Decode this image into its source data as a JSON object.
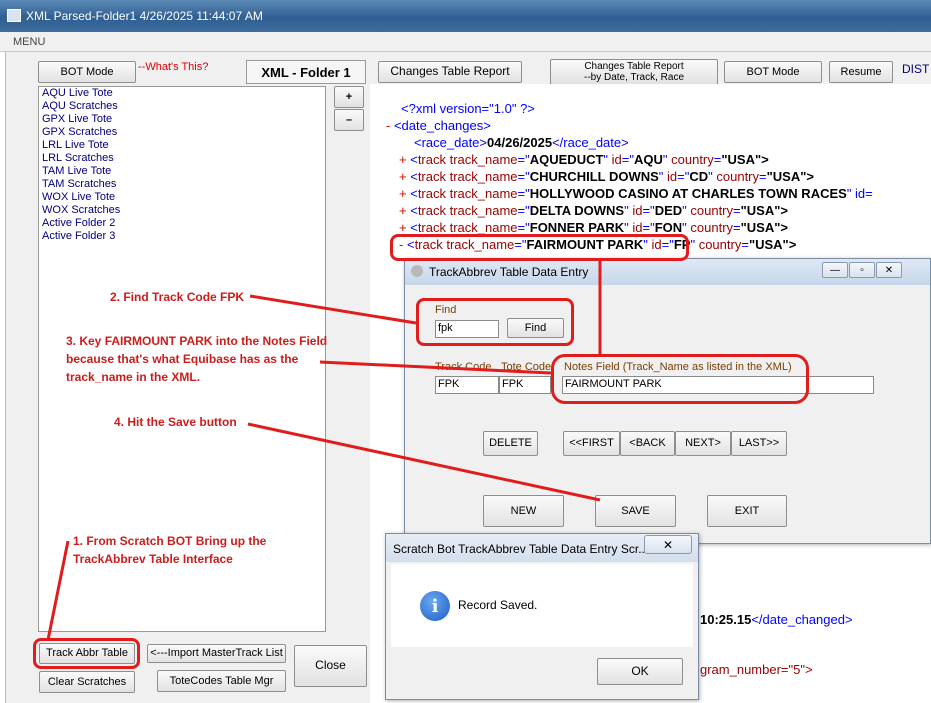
{
  "window": {
    "title": "XML Parsed-Folder1 4/26/2025 11:44:07 AM",
    "menu": "MENU"
  },
  "left_panel": {
    "bot_mode": "BOT Mode",
    "whats_this": "--What's This?",
    "folder_label": "XML - Folder 1",
    "plus": "+",
    "minus": "–",
    "items": [
      "AQU Live Tote",
      "AQU Scratches",
      "GPX Live Tote",
      "GPX Scratches",
      "LRL Live Tote",
      "LRL Scratches",
      "TAM Live Tote",
      "TAM Scratches",
      "WOX Live Tote",
      "WOX Scratches",
      "Active Folder 2",
      "Active Folder 3"
    ],
    "track_abbr_table": "Track Abbr Table",
    "import_master": "<---Import MasterTrack List",
    "close": "Close",
    "clear_scratches": "Clear Scratches",
    "totecodes_mgr": "ToteCodes Table Mgr"
  },
  "toolbar": {
    "changes_report": "Changes Table Report",
    "changes_report_by_line1": "Changes Table Report",
    "changes_report_by_line2": "--by Date, Track, Race",
    "bot_mode": "BOT Mode",
    "resume": "Resume",
    "dist": "DIST"
  },
  "xml": {
    "decl": "<?xml version=\"1.0\" ?>",
    "root_minus": "-",
    "root_tag": "<date_changes>",
    "race_date_open": "<race_date>",
    "race_date_value": "04/26/2025",
    "race_date_close": "</race_date>",
    "tracks": [
      {
        "marker": "+",
        "name": "AQUEDUCT",
        "id": "AQU",
        "country": "\"USA\">"
      },
      {
        "marker": "+",
        "name": "CHURCHILL DOWNS",
        "id": "CD",
        "country": "\"USA\">"
      },
      {
        "marker": "+",
        "name": "HOLLYWOOD CASINO AT CHARLES TOWN RACES",
        "id": "",
        "country": ""
      },
      {
        "marker": "+",
        "name": "DELTA DOWNS",
        "id": "DED",
        "country": "\"USA\">"
      },
      {
        "marker": "+",
        "name": "FONNER PARK",
        "id": "FON",
        "country": "\"USA\">"
      },
      {
        "marker": "-",
        "name": "FAIRMOUNT PARK",
        "id": "FP",
        "country": "\"USA\">"
      }
    ],
    "hollywood_tail": "\" id=",
    "date_changed_value": "10:25.15",
    "date_changed_close": "</date_changed>",
    "program_number_text": "gram_number=\"5\">"
  },
  "dialog": {
    "title": "TrackAbbrev Table Data Entry",
    "find_label": "Find",
    "find_value": "fpk",
    "find_button": "Find",
    "col_track_code": "Track Code",
    "col_tote_code": "Tote Code",
    "col_notes": "Notes Field (Track_Name as listed in the XML)",
    "track_code": "FPK",
    "tote_code": "FPK",
    "notes": "FAIRMOUNT PARK",
    "delete": "DELETE",
    "first": "<<FIRST",
    "back": "<BACK",
    "next": "NEXT>",
    "last": "LAST>>",
    "new": "NEW",
    "save": "SAVE",
    "exit": "EXIT"
  },
  "msgbox": {
    "title": "Scratch Bot TrackAbbrev Table Data Entry Scr...",
    "message": "Record Saved.",
    "ok": "OK"
  },
  "annotations": {
    "step1_line1": "1. From Scratch BOT Bring up the",
    "step1_line2": "TrackAbbrev Table Interface",
    "step2": "2. Find Track Code FPK",
    "step3_line1": "3. Key FAIRMOUNT PARK into the Notes Field",
    "step3_line2": "because that's what Equibase has as the",
    "step3_line3": "track_name in the XML.",
    "step4": "4. Hit the Save button"
  },
  "colors": {
    "annotation_red": "#cc1d1d",
    "xml_tag_blue": "#0000ff",
    "xml_name_maroon": "#990000"
  }
}
